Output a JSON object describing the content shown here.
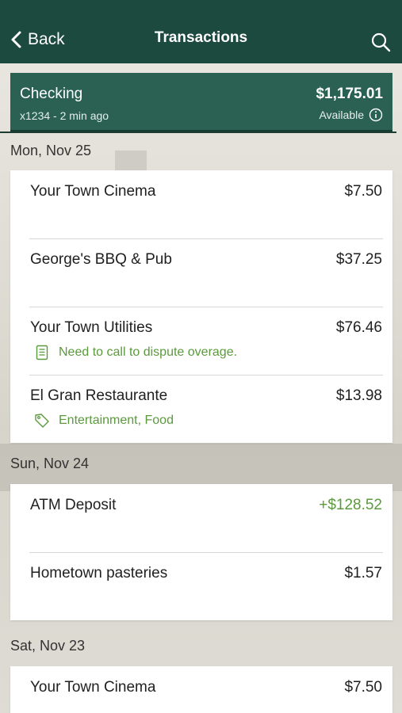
{
  "nav": {
    "back_label": "Back",
    "title": "Transactions"
  },
  "account": {
    "name": "Checking",
    "subtitle": "x1234 - 2 min ago",
    "balance": "$1,175.01",
    "available_label": "Available"
  },
  "groups": [
    {
      "date": "Mon, Nov 25",
      "transactions": [
        {
          "merchant": "Your Town Cinema",
          "amount": "$7.50"
        },
        {
          "merchant": "George's BBQ & Pub",
          "amount": "$37.25"
        },
        {
          "merchant": "Your Town Utilities",
          "amount": "$76.46",
          "note": "Need to call to dispute overage."
        },
        {
          "merchant": "El Gran Restaurante",
          "amount": "$13.98",
          "tags": "Entertainment, Food"
        }
      ]
    },
    {
      "date": "Sun, Nov 24",
      "transactions": [
        {
          "merchant": "ATM Deposit",
          "amount": "+$128.52"
        },
        {
          "merchant": "Hometown pasteries",
          "amount": "$1.57"
        }
      ]
    },
    {
      "date": "Sat, Nov 23",
      "transactions": [
        {
          "merchant": "Your Town Cinema",
          "amount": "$7.50"
        }
      ]
    }
  ],
  "colors": {
    "header": "#1d4a3e",
    "account_banner": "#2a6152",
    "credit": "#5a9a3c",
    "note": "#5a9a3c"
  }
}
